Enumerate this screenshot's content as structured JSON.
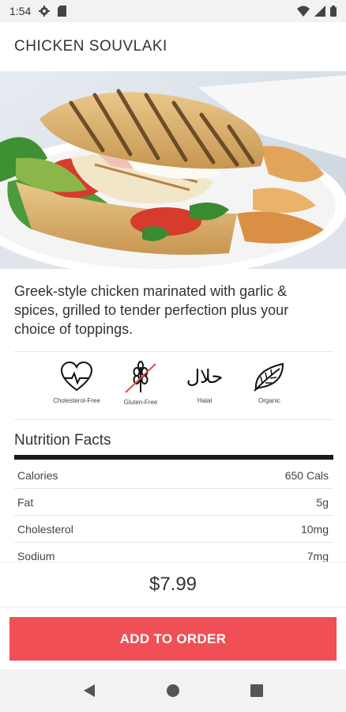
{
  "status_bar": {
    "time": "1:54"
  },
  "product": {
    "title": "CHICKEN SOUVLAKI",
    "description": "Greek-style chicken marinated with garlic & spices, grilled to tender perfection plus your choice of toppings.",
    "price": "$7.99"
  },
  "diet_icons": [
    {
      "icon": "heart-pulse-icon",
      "label": "Cholesterol-Free"
    },
    {
      "icon": "wheat-crossed-icon",
      "label": "Gluten-Free"
    },
    {
      "icon": "halal-icon",
      "label": "Halal",
      "glyph": "حلال"
    },
    {
      "icon": "leaf-icon",
      "label": "Organic"
    }
  ],
  "nutrition": {
    "title": "Nutrition Facts",
    "rows": [
      {
        "name": "Calories",
        "value": "650 Cals"
      },
      {
        "name": "Fat",
        "value": "5g"
      },
      {
        "name": "Cholesterol",
        "value": "10mg"
      },
      {
        "name": "Sodium",
        "value": "7mg"
      }
    ]
  },
  "actions": {
    "add_to_order": "ADD TO ORDER"
  },
  "colors": {
    "accent": "#ef4f55",
    "nutrition_bar": "#1a1a1a"
  }
}
